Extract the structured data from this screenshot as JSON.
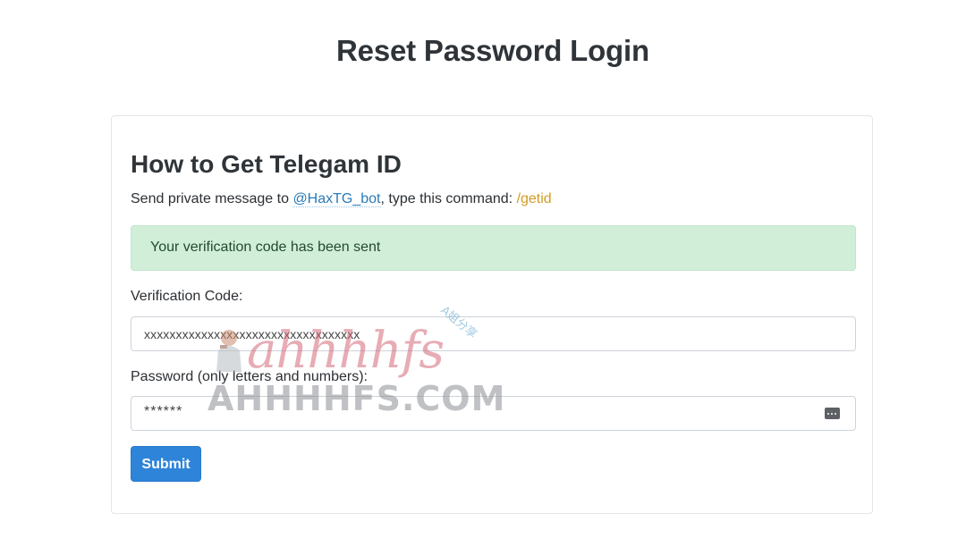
{
  "page": {
    "title": "Reset Password Login"
  },
  "card": {
    "heading": "How to Get Telegam ID",
    "instruction": {
      "prefix": "Send private message to ",
      "bot_handle": "@HaxTG_bot",
      "middle": ", type this command: ",
      "command": "/getid"
    },
    "alert": "Your verification code has been sent",
    "verification": {
      "label": "Verification Code:",
      "value": "xxxxxxxxxxxxxxxxxxxxxxxxxxxxxxxxxx"
    },
    "password": {
      "label": "Password (only letters and numbers):",
      "value": "******",
      "icon": "password-manager-icon"
    },
    "submit_label": "Submit"
  },
  "watermark": {
    "script_text": "ahhhhfs",
    "domain_text": "AHHHHFS.COM",
    "cjk_text": "A姐分享"
  },
  "colors": {
    "primary_button": "#2e84d9",
    "link": "#2a7ab8",
    "command": "#d39a22",
    "alert_bg": "#d1eed9",
    "alert_text": "#234a2c"
  }
}
